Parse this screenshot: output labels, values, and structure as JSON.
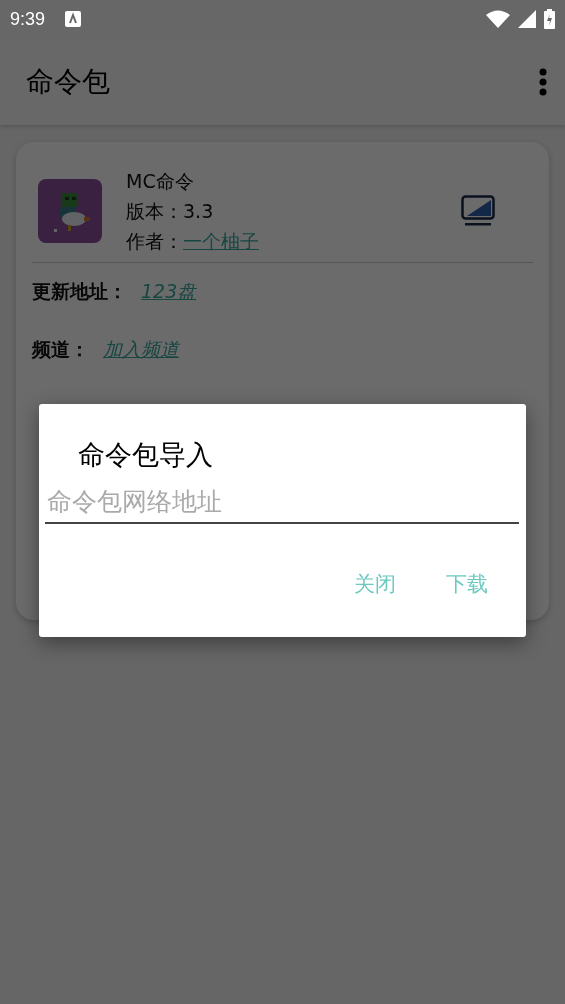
{
  "status_bar": {
    "time": "9:39"
  },
  "app_bar": {
    "title": "命令包"
  },
  "package": {
    "name": "MC命令",
    "version_label": "版本：",
    "version": "3.3",
    "author_label": "作者：",
    "author": "一个柚子"
  },
  "fields": [
    {
      "label": "更新地址：",
      "link": "123盘"
    },
    {
      "label": "频道：",
      "link": "加入频道"
    }
  ],
  "dialog": {
    "title": "命令包导入",
    "input": {
      "placeholder": "命令包网络地址"
    },
    "buttons": [
      "关闭",
      "下载"
    ]
  }
}
